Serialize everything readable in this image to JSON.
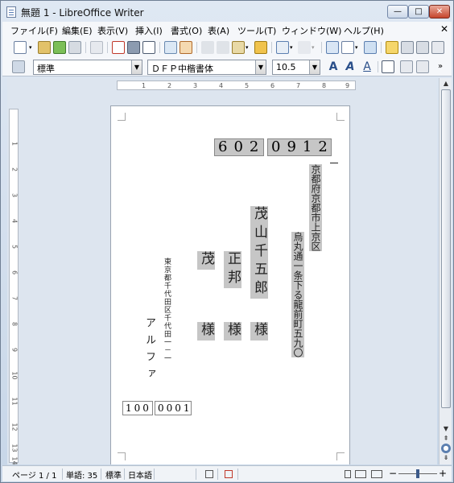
{
  "window": {
    "title": "無題 1 - LibreOffice Writer",
    "minimize_glyph": "—",
    "maximize_glyph": "□",
    "close_glyph": "✕"
  },
  "menu": {
    "items": [
      "ファイル(F)",
      "編集(E)",
      "表示(V)",
      "挿入(I)",
      "書式(O)",
      "表(A)",
      "ツール(T)",
      "ウィンドウ(W)",
      "ヘルプ(H)"
    ],
    "close_glyph": "✕"
  },
  "formatting": {
    "paragraph_style": "標準",
    "font_name": "ＤＦＰ中楷書体",
    "font_size": "10.5"
  },
  "ruler": {
    "h_numbers": [
      "1",
      "2",
      "3",
      "4",
      "5",
      "6",
      "7",
      "8",
      "9"
    ],
    "v_numbers": [
      "1",
      "2",
      "3",
      "4",
      "5",
      "6",
      "7",
      "8",
      "9",
      "10",
      "11",
      "12",
      "13",
      "14"
    ]
  },
  "document": {
    "postal_code": "6020912",
    "address_line1": "京都府京都市上京区",
    "address_line2": "烏丸通一条下る龍前町五九〇",
    "recipient1": "茂山千五郎",
    "recipient1_suffix": "様",
    "recipient2": "正邦",
    "recipient2_suffix": "様",
    "recipient3": "茂",
    "recipient3_suffix": "様",
    "sender_address": "東京都千代田区千代田一－一",
    "sender_name": "アルファ",
    "sender_postal_a": "100",
    "sender_postal_b": "0001"
  },
  "status": {
    "page": "ページ 1 / 1",
    "words": "単語: 35",
    "style": "標準",
    "language": "日本語"
  },
  "colors": {
    "field_shading": "#c6c6c6",
    "window_chrome": "#dfe8f3"
  }
}
